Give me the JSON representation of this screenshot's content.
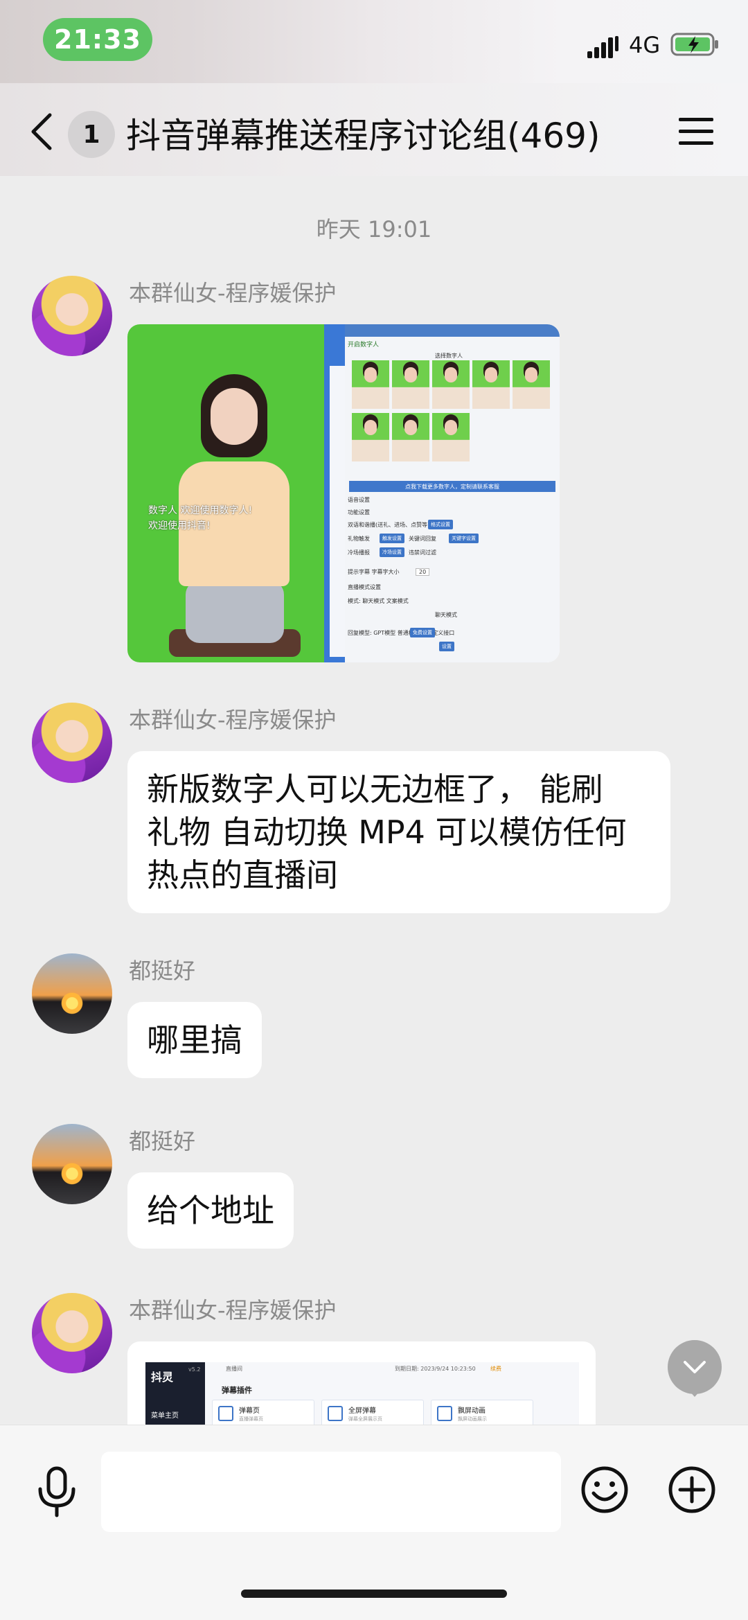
{
  "status_bar": {
    "time": "21:33",
    "network": "4G"
  },
  "nav": {
    "unread_count": "1",
    "title": "抖音弹幕推送程序讨论组(469)"
  },
  "chat": {
    "timestamp": "昨天 19:01",
    "messages": [
      {
        "sender": "本群仙女-程序媛保护",
        "type": "image"
      },
      {
        "sender": "本群仙女-程序媛保护",
        "type": "text",
        "lines": [
          "新版数字人可以无边框了， 能刷",
          "礼物 自动切换 MP4 可以模仿任何",
          "热点的直播间"
        ]
      },
      {
        "sender": "都挺好",
        "type": "text",
        "text": "哪里搞"
      },
      {
        "sender": "都挺好",
        "type": "text",
        "text": "给个地址"
      },
      {
        "sender": "本群仙女-程序媛保护",
        "type": "image"
      }
    ],
    "image1": {
      "welcome_lines": [
        "数字人 欢迎使用数字人!",
        "欢迎使用抖音!"
      ],
      "panel_title": "开启数字人",
      "select_label": "选择数字人",
      "download_bar": "点我下载更多数字人，定制请联系客服",
      "rows": [
        "语音设置",
        "功能设置",
        "双语和谐播(送礼、进场、点赞等)",
        "礼物触发",
        "关键词回复",
        "冷场播报",
        "违禁词过滤",
        "提示字幕  字幕字大小",
        "直播模式设置",
        "模式:  聊天模式    文案模式",
        "聊天模式",
        "回复模型:  GPT模型    普通机器人  自定义接口"
      ],
      "buttons": [
        "格式设置",
        "触发设置",
        "关键字设置",
        "冷场设置",
        "免费设置",
        "设置"
      ],
      "font_size_value": "20"
    },
    "image2": {
      "logo": "抖灵",
      "version": "v5.2",
      "menu": "菜单主页",
      "breadcrumb": "直播间",
      "expire": "到期日期: 2023/9/24 10:23:50",
      "renew": "续费",
      "section": "弹幕插件",
      "cards": [
        {
          "title": "弹幕页",
          "sub": "直播弹幕页"
        },
        {
          "title": "全屏弹幕",
          "sub": "弹幕全屏展示页"
        },
        {
          "title": "飘屏动画",
          "sub": "飘屏动画展示"
        }
      ]
    }
  },
  "input": {
    "placeholder": ""
  },
  "icons": {
    "back": "chevron-left-icon",
    "menu": "hamburger-menu-icon",
    "mic": "microphone-icon",
    "emoji": "emoji-icon",
    "plus": "plus-circle-icon",
    "scroll": "chevron-down-icon"
  },
  "colors": {
    "time_pill": "#5dc463",
    "chat_bg": "#ededed",
    "bubble": "#ffffff",
    "muted_text": "#8a8a8a"
  }
}
